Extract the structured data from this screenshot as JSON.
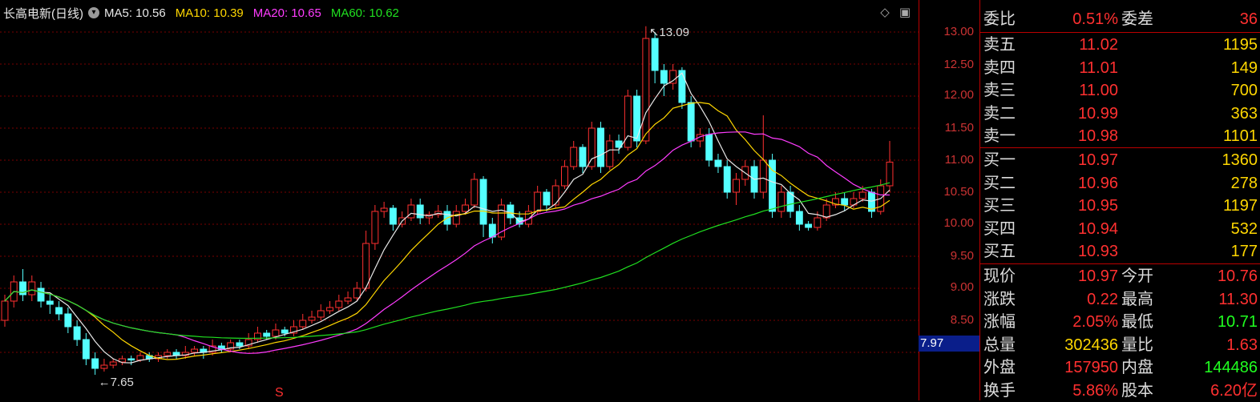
{
  "header": {
    "stock_name": "长高电新(日线)",
    "ma": [
      {
        "label": "MA5: 10.56",
        "color": "#e8e8e8"
      },
      {
        "label": "MA10: 10.39",
        "color": "#ffd700"
      },
      {
        "label": "MA20: 10.65",
        "color": "#ff3cff"
      },
      {
        "label": "MA60: 10.62",
        "color": "#20e020"
      }
    ]
  },
  "axis": {
    "ticks": [
      "13.00",
      "12.50",
      "12.00",
      "11.50",
      "11.00",
      "10.50",
      "10.00",
      "9.50",
      "9.00",
      "8.50"
    ],
    "current_tag": "7.97"
  },
  "annotations": {
    "high_label": "13.09",
    "low_label": "7.65",
    "signal": "S"
  },
  "quote_panel": {
    "weibi": {
      "label": "委比",
      "value": "0.51%",
      "label2": "委差",
      "value2": "36"
    },
    "sell": [
      {
        "label": "卖五",
        "price": "11.02",
        "volume": "1195"
      },
      {
        "label": "卖四",
        "price": "11.01",
        "volume": "149"
      },
      {
        "label": "卖三",
        "price": "11.00",
        "volume": "700"
      },
      {
        "label": "卖二",
        "price": "10.99",
        "volume": "363"
      },
      {
        "label": "卖一",
        "price": "10.98",
        "volume": "1101"
      }
    ],
    "buy": [
      {
        "label": "买一",
        "price": "10.97",
        "volume": "1360"
      },
      {
        "label": "买二",
        "price": "10.96",
        "volume": "278"
      },
      {
        "label": "买三",
        "price": "10.95",
        "volume": "1197"
      },
      {
        "label": "买四",
        "price": "10.94",
        "volume": "532"
      },
      {
        "label": "买五",
        "price": "10.93",
        "volume": "177"
      }
    ],
    "stats": [
      {
        "label": "现价",
        "value": "10.97",
        "vcolor": "red",
        "label2": "今开",
        "value2": "10.76",
        "v2color": "red"
      },
      {
        "label": "涨跌",
        "value": "0.22",
        "vcolor": "red",
        "label2": "最高",
        "value2": "11.30",
        "v2color": "red"
      },
      {
        "label": "涨幅",
        "value": "2.05%",
        "vcolor": "red",
        "label2": "最低",
        "value2": "10.71",
        "v2color": "green"
      },
      {
        "label": "总量",
        "value": "302436",
        "vcolor": "yellow",
        "label2": "量比",
        "value2": "1.63",
        "v2color": "red"
      },
      {
        "label": "外盘",
        "value": "157950",
        "vcolor": "red",
        "label2": "内盘",
        "value2": "144486",
        "v2color": "green"
      },
      {
        "label": "换手",
        "value": "5.86%",
        "vcolor": "red",
        "label2": "股本",
        "value2": "6.20亿",
        "v2color": "red"
      }
    ]
  },
  "chart_data": {
    "type": "candlestick",
    "y_range": [
      7.5,
      13.3
    ],
    "candles": [
      [
        8.5,
        8.8,
        8.9,
        8.4
      ],
      [
        8.8,
        9.1,
        9.2,
        8.7
      ],
      [
        9.1,
        8.9,
        9.3,
        8.8
      ],
      [
        8.9,
        9.1,
        9.2,
        8.8
      ],
      [
        9.0,
        8.8,
        9.1,
        8.7
      ],
      [
        8.8,
        8.75,
        8.9,
        8.6
      ],
      [
        8.7,
        8.6,
        8.8,
        8.5
      ],
      [
        8.6,
        8.4,
        8.7,
        8.3
      ],
      [
        8.4,
        8.2,
        8.5,
        8.1
      ],
      [
        8.2,
        7.9,
        8.3,
        7.8
      ],
      [
        7.9,
        7.75,
        8.0,
        7.65
      ],
      [
        7.75,
        7.8,
        7.9,
        7.7
      ],
      [
        7.8,
        7.85,
        7.9,
        7.75
      ],
      [
        7.85,
        7.9,
        7.95,
        7.8
      ],
      [
        7.9,
        7.88,
        7.95,
        7.8
      ],
      [
        7.88,
        7.95,
        8.0,
        7.85
      ],
      [
        7.95,
        7.9,
        8.0,
        7.85
      ],
      [
        7.9,
        7.95,
        8.0,
        7.85
      ],
      [
        7.95,
        8.0,
        8.05,
        7.9
      ],
      [
        8.0,
        7.95,
        8.05,
        7.9
      ],
      [
        7.95,
        8.0,
        8.1,
        7.9
      ],
      [
        8.0,
        8.05,
        8.1,
        7.95
      ],
      [
        8.05,
        8.0,
        8.1,
        7.9
      ],
      [
        8.0,
        8.1,
        8.2,
        7.95
      ],
      [
        8.1,
        8.05,
        8.15,
        8.0
      ],
      [
        8.05,
        8.15,
        8.2,
        8.0
      ],
      [
        8.15,
        8.1,
        8.2,
        8.05
      ],
      [
        8.1,
        8.2,
        8.3,
        8.05
      ],
      [
        8.2,
        8.3,
        8.4,
        8.15
      ],
      [
        8.3,
        8.25,
        8.35,
        8.2
      ],
      [
        8.25,
        8.35,
        8.45,
        8.2
      ],
      [
        8.35,
        8.3,
        8.4,
        8.25
      ],
      [
        8.3,
        8.4,
        8.5,
        8.25
      ],
      [
        8.4,
        8.5,
        8.6,
        8.35
      ],
      [
        8.5,
        8.55,
        8.65,
        8.45
      ],
      [
        8.55,
        8.65,
        8.75,
        8.5
      ],
      [
        8.65,
        8.7,
        8.8,
        8.6
      ],
      [
        8.7,
        8.8,
        8.9,
        8.65
      ],
      [
        8.8,
        8.85,
        8.95,
        8.75
      ],
      [
        8.85,
        9.0,
        9.1,
        8.8
      ],
      [
        9.0,
        9.7,
        9.9,
        8.95
      ],
      [
        9.7,
        10.2,
        10.3,
        9.6
      ],
      [
        10.2,
        10.25,
        10.35,
        10.1
      ],
      [
        10.25,
        10.0,
        10.3,
        9.9
      ],
      [
        10.0,
        10.1,
        10.2,
        9.95
      ],
      [
        10.1,
        10.3,
        10.4,
        10.05
      ],
      [
        10.3,
        10.1,
        10.4,
        10.0
      ],
      [
        10.1,
        10.15,
        10.2,
        10.0
      ],
      [
        10.15,
        10.2,
        10.3,
        10.1
      ],
      [
        10.2,
        10.0,
        10.3,
        9.9
      ],
      [
        10.0,
        10.2,
        10.3,
        9.95
      ],
      [
        10.2,
        10.3,
        10.4,
        10.15
      ],
      [
        10.3,
        10.7,
        10.8,
        10.25
      ],
      [
        10.7,
        10.0,
        10.75,
        9.8
      ],
      [
        10.0,
        9.8,
        10.1,
        9.7
      ],
      [
        9.8,
        10.3,
        10.4,
        9.75
      ],
      [
        10.3,
        10.1,
        10.35,
        10.0
      ],
      [
        10.1,
        10.0,
        10.2,
        9.95
      ],
      [
        10.0,
        10.2,
        10.3,
        9.95
      ],
      [
        10.2,
        10.5,
        10.6,
        10.15
      ],
      [
        10.5,
        10.3,
        10.55,
        10.2
      ],
      [
        10.3,
        10.6,
        10.7,
        10.25
      ],
      [
        10.6,
        10.9,
        11.0,
        10.55
      ],
      [
        10.9,
        11.2,
        11.3,
        10.85
      ],
      [
        11.2,
        10.9,
        11.25,
        10.8
      ],
      [
        10.9,
        11.5,
        11.6,
        10.85
      ],
      [
        11.5,
        10.9,
        11.6,
        10.8
      ],
      [
        10.9,
        11.3,
        11.4,
        10.85
      ],
      [
        11.3,
        11.2,
        11.4,
        11.1
      ],
      [
        11.2,
        12.0,
        12.1,
        11.15
      ],
      [
        12.0,
        11.3,
        12.1,
        11.2
      ],
      [
        11.3,
        12.9,
        13.09,
        11.25
      ],
      [
        12.9,
        12.4,
        13.0,
        12.2
      ],
      [
        12.4,
        12.2,
        12.5,
        12.0
      ],
      [
        12.2,
        12.4,
        12.5,
        12.1
      ],
      [
        12.4,
        11.9,
        12.45,
        11.8
      ],
      [
        11.9,
        11.3,
        12.0,
        11.2
      ],
      [
        11.3,
        11.4,
        11.5,
        11.2
      ],
      [
        11.4,
        11.0,
        11.5,
        10.9
      ],
      [
        11.0,
        10.9,
        11.1,
        10.8
      ],
      [
        10.9,
        10.5,
        11.0,
        10.4
      ],
      [
        10.5,
        10.7,
        10.8,
        10.3
      ],
      [
        10.7,
        10.9,
        11.0,
        10.6
      ],
      [
        10.9,
        10.5,
        11.0,
        10.4
      ],
      [
        10.5,
        11.0,
        11.7,
        10.4
      ],
      [
        11.0,
        10.2,
        11.1,
        10.1
      ],
      [
        10.2,
        10.5,
        10.6,
        10.1
      ],
      [
        10.5,
        10.2,
        10.6,
        10.1
      ],
      [
        10.2,
        10.0,
        10.3,
        9.9
      ],
      [
        10.0,
        9.95,
        10.05,
        9.9
      ],
      [
        9.95,
        10.1,
        10.2,
        9.9
      ],
      [
        10.1,
        10.3,
        10.4,
        10.05
      ],
      [
        10.3,
        10.4,
        10.5,
        10.25
      ],
      [
        10.4,
        10.3,
        10.5,
        10.2
      ],
      [
        10.3,
        10.4,
        10.5,
        10.25
      ],
      [
        10.4,
        10.5,
        10.6,
        10.35
      ],
      [
        10.5,
        10.2,
        10.55,
        10.1
      ],
      [
        10.2,
        10.6,
        10.7,
        10.15
      ],
      [
        10.6,
        10.97,
        11.3,
        10.5
      ]
    ]
  }
}
